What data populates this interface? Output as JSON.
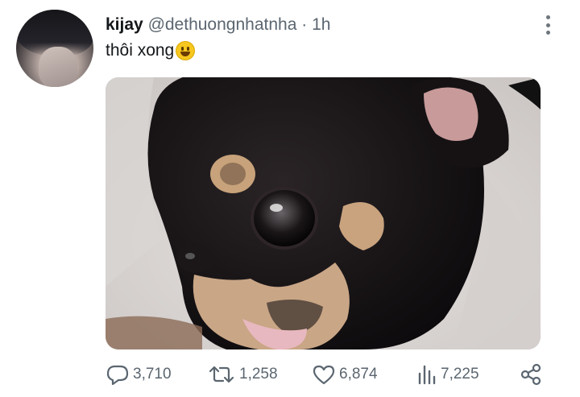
{
  "tweet": {
    "author_name": "kijay",
    "author_handle": "@dethuongnhatnha",
    "separator": "·",
    "time": "1h",
    "text": "thôi xong",
    "emoji_icon": "grinning-face-emoji",
    "media_alt_icon": "chihuahua-puppy-photo"
  },
  "actions": {
    "reply_count": "3,710",
    "retweet_count": "1,258",
    "like_count": "6,874",
    "views_count": "7,225"
  },
  "colors": {
    "text_primary": "#14171a",
    "text_secondary": "#5b6670"
  }
}
